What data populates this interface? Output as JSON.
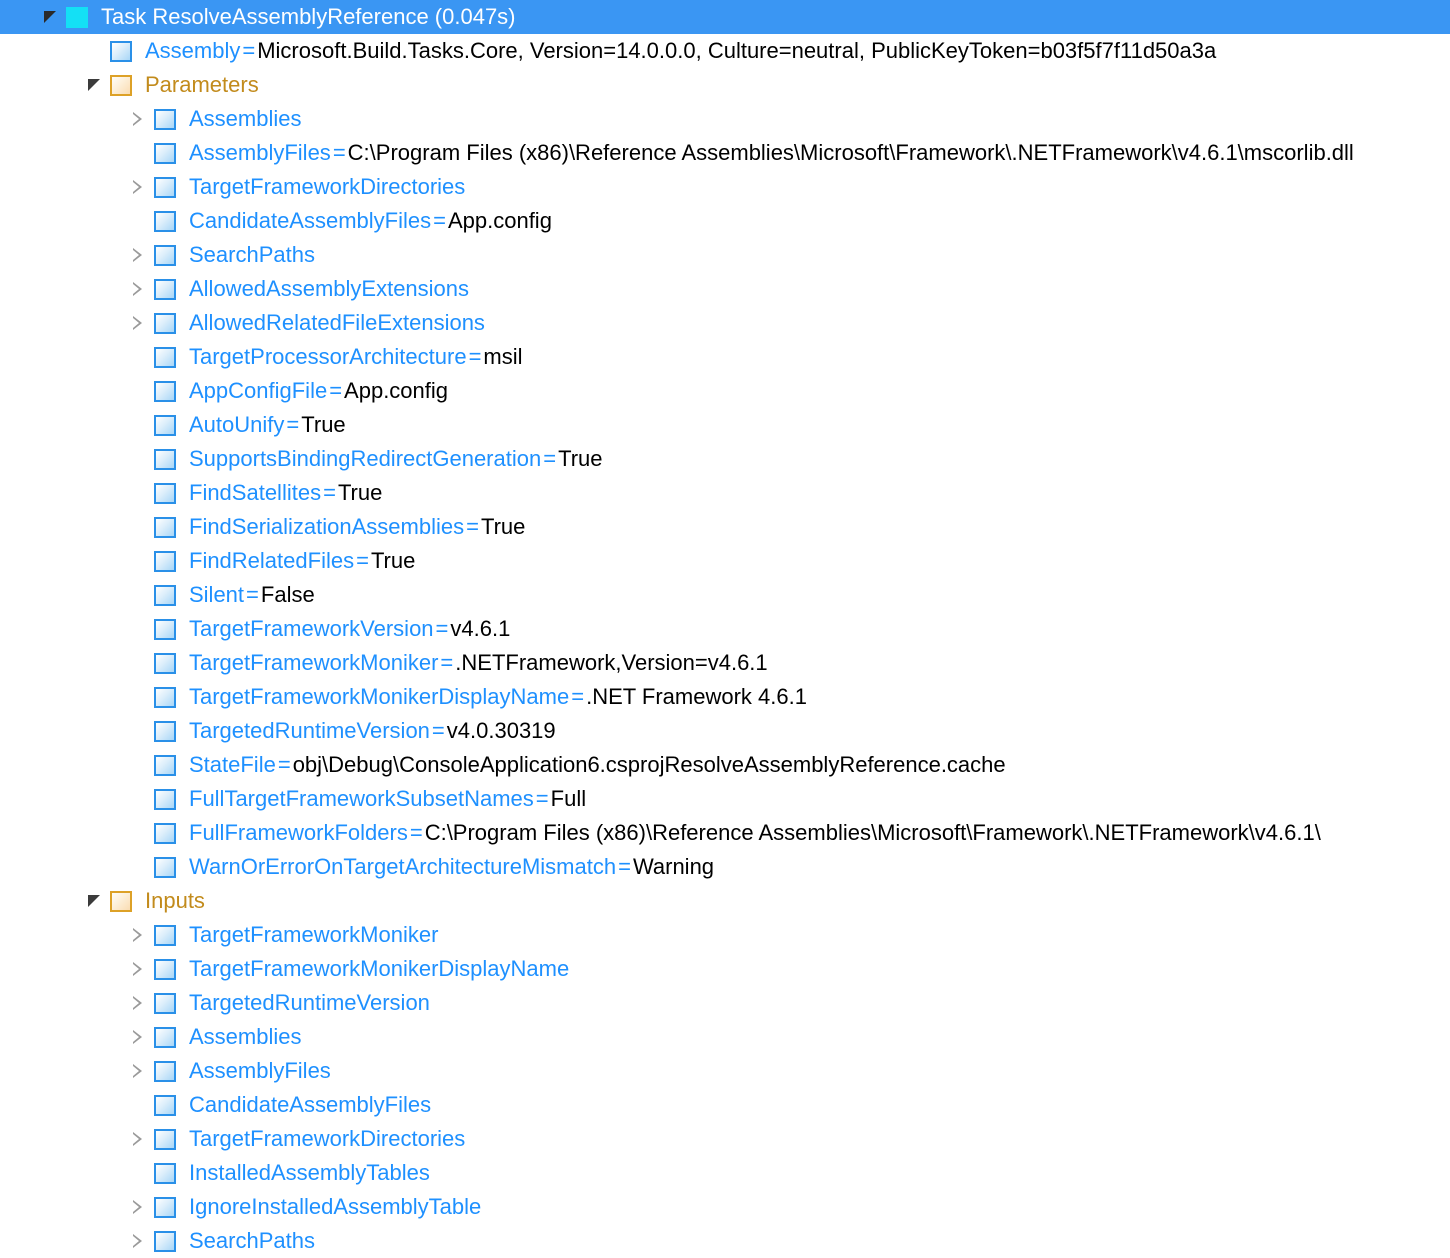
{
  "view": {
    "name": "msbuild-structured-log-viewer-tree",
    "selected_row_color": "#3a96f3",
    "item_icon_color": "#2a90e8",
    "folder_icon_color": "#dda127",
    "task_icon_color": "#14e0f5",
    "link_text_color": "#1e90ff",
    "folder_text_color": "#c28b1c"
  },
  "nodes": [
    {
      "depth": 0,
      "icon": "task",
      "expander": "expanded",
      "selected": true,
      "name": "Task ResolveAssemblyReference (0.047s)"
    },
    {
      "depth": 1,
      "icon": "item",
      "expander": "none",
      "name": "Assembly",
      "eq": "=",
      "value": "Microsoft.Build.Tasks.Core, Version=14.0.0.0, Culture=neutral, PublicKeyToken=b03f5f7f11d50a3a"
    },
    {
      "depth": 1,
      "icon": "folder",
      "expander": "expanded",
      "name": "Parameters"
    },
    {
      "depth": 2,
      "icon": "item",
      "expander": "collapsed",
      "name": "Assemblies"
    },
    {
      "depth": 2,
      "icon": "item",
      "expander": "none",
      "name": "AssemblyFiles",
      "eq": "=",
      "value": "C:\\Program Files (x86)\\Reference Assemblies\\Microsoft\\Framework\\.NETFramework\\v4.6.1\\mscorlib.dll"
    },
    {
      "depth": 2,
      "icon": "item",
      "expander": "collapsed",
      "name": "TargetFrameworkDirectories"
    },
    {
      "depth": 2,
      "icon": "item",
      "expander": "none",
      "name": "CandidateAssemblyFiles",
      "eq": "=",
      "value": "App.config"
    },
    {
      "depth": 2,
      "icon": "item",
      "expander": "collapsed",
      "name": "SearchPaths"
    },
    {
      "depth": 2,
      "icon": "item",
      "expander": "collapsed",
      "name": "AllowedAssemblyExtensions"
    },
    {
      "depth": 2,
      "icon": "item",
      "expander": "collapsed",
      "name": "AllowedRelatedFileExtensions"
    },
    {
      "depth": 2,
      "icon": "item",
      "expander": "none",
      "name": "TargetProcessorArchitecture",
      "eq": "=",
      "value": "msil"
    },
    {
      "depth": 2,
      "icon": "item",
      "expander": "none",
      "name": "AppConfigFile",
      "eq": "=",
      "value": "App.config"
    },
    {
      "depth": 2,
      "icon": "item",
      "expander": "none",
      "name": "AutoUnify",
      "eq": "=",
      "value": "True"
    },
    {
      "depth": 2,
      "icon": "item",
      "expander": "none",
      "name": "SupportsBindingRedirectGeneration",
      "eq": "=",
      "value": "True"
    },
    {
      "depth": 2,
      "icon": "item",
      "expander": "none",
      "name": "FindSatellites",
      "eq": "=",
      "value": "True"
    },
    {
      "depth": 2,
      "icon": "item",
      "expander": "none",
      "name": "FindSerializationAssemblies",
      "eq": "=",
      "value": "True"
    },
    {
      "depth": 2,
      "icon": "item",
      "expander": "none",
      "name": "FindRelatedFiles",
      "eq": "=",
      "value": "True"
    },
    {
      "depth": 2,
      "icon": "item",
      "expander": "none",
      "name": "Silent",
      "eq": "=",
      "value": "False"
    },
    {
      "depth": 2,
      "icon": "item",
      "expander": "none",
      "name": "TargetFrameworkVersion",
      "eq": "=",
      "value": "v4.6.1"
    },
    {
      "depth": 2,
      "icon": "item",
      "expander": "none",
      "name": "TargetFrameworkMoniker",
      "eq": "=",
      "value": ".NETFramework,Version=v4.6.1"
    },
    {
      "depth": 2,
      "icon": "item",
      "expander": "none",
      "name": "TargetFrameworkMonikerDisplayName",
      "eq": "=",
      "value": ".NET Framework 4.6.1"
    },
    {
      "depth": 2,
      "icon": "item",
      "expander": "none",
      "name": "TargetedRuntimeVersion",
      "eq": "=",
      "value": "v4.0.30319"
    },
    {
      "depth": 2,
      "icon": "item",
      "expander": "none",
      "name": "StateFile",
      "eq": "=",
      "value": "obj\\Debug\\ConsoleApplication6.csprojResolveAssemblyReference.cache"
    },
    {
      "depth": 2,
      "icon": "item",
      "expander": "none",
      "name": "FullTargetFrameworkSubsetNames",
      "eq": "=",
      "value": "Full"
    },
    {
      "depth": 2,
      "icon": "item",
      "expander": "none",
      "name": "FullFrameworkFolders",
      "eq": "=",
      "value": "C:\\Program Files (x86)\\Reference Assemblies\\Microsoft\\Framework\\.NETFramework\\v4.6.1\\"
    },
    {
      "depth": 2,
      "icon": "item",
      "expander": "none",
      "name": "WarnOrErrorOnTargetArchitectureMismatch",
      "eq": "=",
      "value": "Warning"
    },
    {
      "depth": 1,
      "icon": "folder",
      "expander": "expanded",
      "name": "Inputs"
    },
    {
      "depth": 2,
      "icon": "item",
      "expander": "collapsed",
      "name": "TargetFrameworkMoniker"
    },
    {
      "depth": 2,
      "icon": "item",
      "expander": "collapsed",
      "name": "TargetFrameworkMonikerDisplayName"
    },
    {
      "depth": 2,
      "icon": "item",
      "expander": "collapsed",
      "name": "TargetedRuntimeVersion"
    },
    {
      "depth": 2,
      "icon": "item",
      "expander": "collapsed",
      "name": "Assemblies"
    },
    {
      "depth": 2,
      "icon": "item",
      "expander": "collapsed",
      "name": "AssemblyFiles"
    },
    {
      "depth": 2,
      "icon": "item",
      "expander": "none",
      "name": "CandidateAssemblyFiles"
    },
    {
      "depth": 2,
      "icon": "item",
      "expander": "collapsed",
      "name": "TargetFrameworkDirectories"
    },
    {
      "depth": 2,
      "icon": "item",
      "expander": "none",
      "name": "InstalledAssemblyTables"
    },
    {
      "depth": 2,
      "icon": "item",
      "expander": "collapsed",
      "name": "IgnoreInstalledAssemblyTable"
    },
    {
      "depth": 2,
      "icon": "item",
      "expander": "collapsed",
      "name": "SearchPaths"
    }
  ]
}
